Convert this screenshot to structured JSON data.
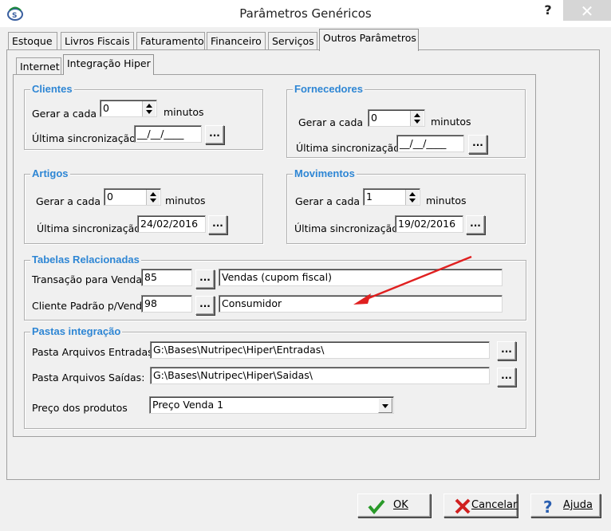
{
  "window": {
    "title": "Parâmetros Genéricos",
    "help_label": "?",
    "close_label": "✕"
  },
  "tabs": [
    {
      "label": "Estoque"
    },
    {
      "label": "Livros Fiscais"
    },
    {
      "label": "Faturamento"
    },
    {
      "label": "Financeiro"
    },
    {
      "label": "Serviços"
    },
    {
      "label": "Outros Parâmetros"
    }
  ],
  "subtabs": [
    {
      "label": "Internet"
    },
    {
      "label": "Integração Hiper"
    }
  ],
  "clientes": {
    "title": "Clientes",
    "gerar_label": "Gerar a cada",
    "gerar_value": "0",
    "unit": "minutos",
    "sync_label": "Última sincronização",
    "sync_value": "__/__/____",
    "browse": "..."
  },
  "fornecedores": {
    "title": "Fornecedores",
    "gerar_label": "Gerar a cada",
    "gerar_value": "0",
    "unit": "minutos",
    "sync_label": "Última sincronização",
    "sync_value": "__/__/____",
    "browse": "..."
  },
  "artigos": {
    "title": "Artigos",
    "gerar_label": "Gerar a cada",
    "gerar_value": "0",
    "unit": "minutos",
    "sync_label": "Última sincronização",
    "sync_value": "24/02/2016",
    "browse": "..."
  },
  "movimentos": {
    "title": "Movimentos",
    "gerar_label": "Gerar a cada",
    "gerar_value": "1",
    "unit": "minutos",
    "sync_label": "Última sincronização",
    "sync_value": "19/02/2016",
    "browse": "..."
  },
  "tabelas": {
    "title": "Tabelas Relacionadas",
    "transacao_label": "Transação para Vendas:",
    "transacao_code": "85",
    "transacao_desc": "Vendas (cupom fiscal)",
    "cliente_label": "Cliente Padrão p/Vendas",
    "cliente_code": "98",
    "cliente_desc": "Consumidor",
    "browse": "..."
  },
  "pastas": {
    "title": "Pastas integração",
    "entradas_label": "Pasta Arquivos Entradas:",
    "entradas_value": "G:\\Bases\\Nutripec\\Hiper\\Entradas\\",
    "saidas_label": "Pasta Arquivos Saídas:",
    "saidas_value": "G:\\Bases\\Nutripec\\Hiper\\Saidas\\",
    "preco_label": "Preço dos produtos",
    "preco_value": "Preço Venda 1",
    "browse": "..."
  },
  "buttons": {
    "ok": "OK",
    "cancel": "Cancelar",
    "help": "Ajuda"
  },
  "colors": {
    "group_title": "#2e86d4",
    "annotation_arrow": "#e02020",
    "ok_check": "#2a9a2a",
    "cancel_x": "#d02020",
    "help_q": "#2a5fb0"
  }
}
